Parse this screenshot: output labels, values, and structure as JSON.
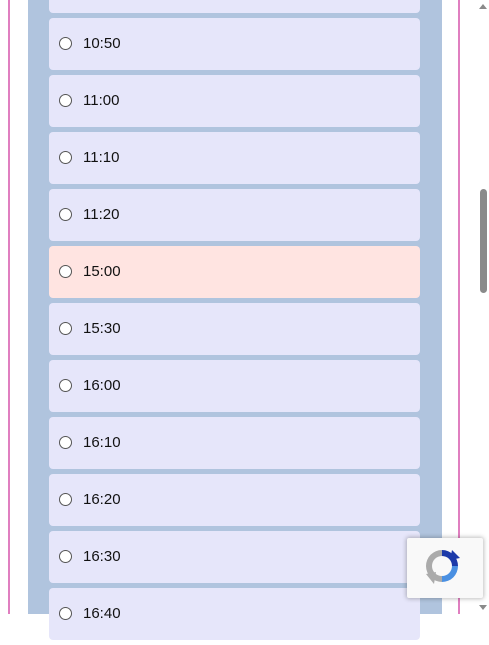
{
  "time_slots": [
    {
      "label": ""
    },
    {
      "label": "10:50"
    },
    {
      "label": "11:00"
    },
    {
      "label": "11:10"
    },
    {
      "label": "11:20"
    },
    {
      "label": "15:00",
      "highlighted": true
    },
    {
      "label": "15:30"
    },
    {
      "label": "16:00"
    },
    {
      "label": "16:10"
    },
    {
      "label": "16:20"
    },
    {
      "label": "16:30"
    },
    {
      "label": "16:40"
    }
  ],
  "colors": {
    "panel_background": "#b0c4de",
    "slot_background": "#e6e6fa",
    "highlight_background": "#ffe4e1",
    "frame_line": "#e07fc0"
  },
  "icons": {
    "recaptcha": "recaptcha-icon",
    "radio": "radio-button"
  }
}
